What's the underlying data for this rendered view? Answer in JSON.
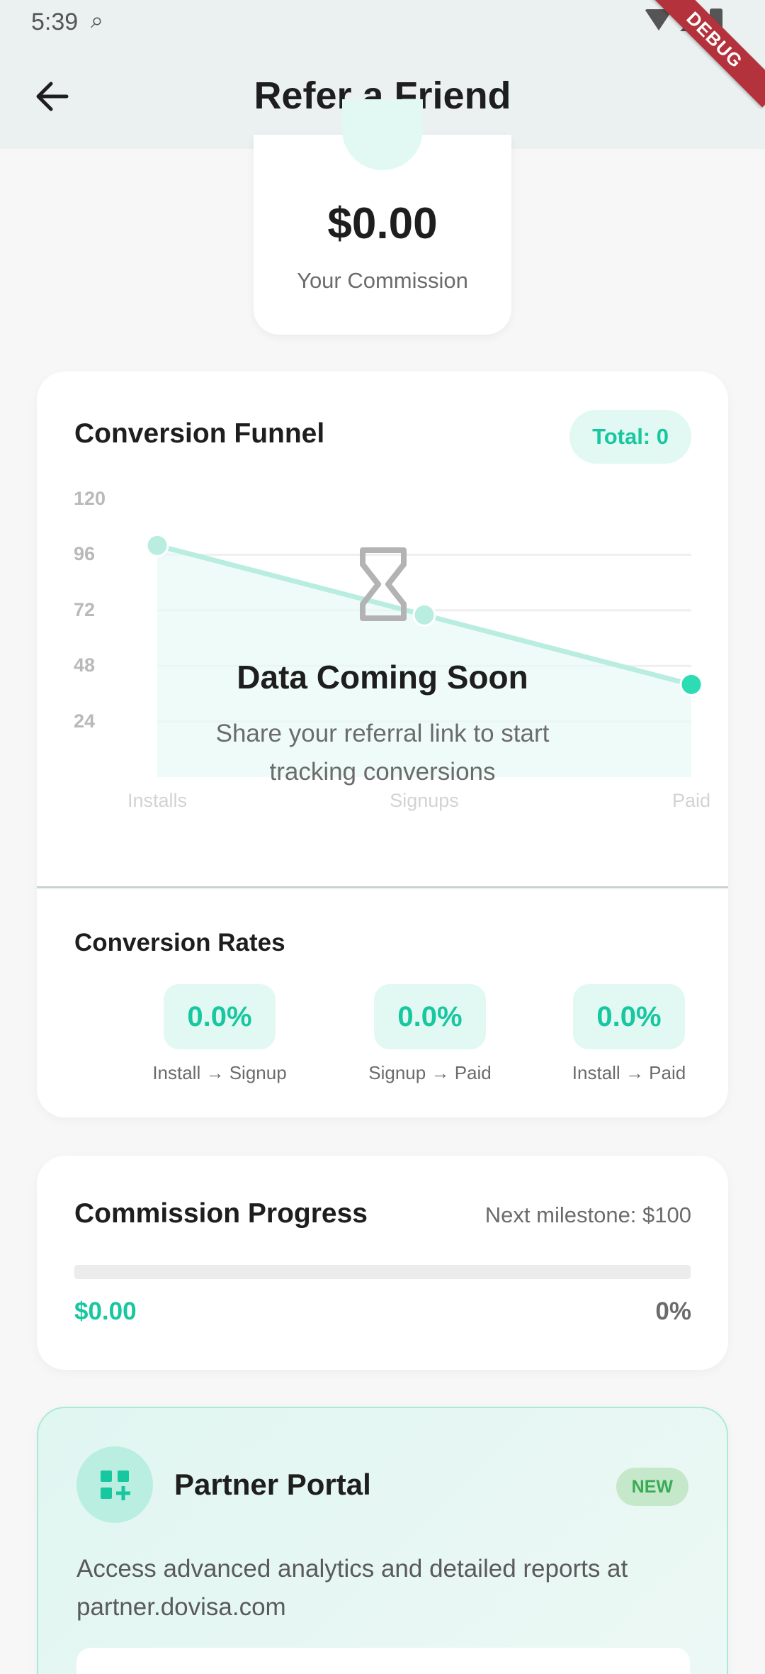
{
  "status_bar": {
    "time": "5:39",
    "debug_label": "DEBUG"
  },
  "app_bar": {
    "title": "Refer a Friend",
    "back_icon": "arrow-left-icon"
  },
  "commission": {
    "value": "$0.00",
    "label": "Your Commission"
  },
  "funnel": {
    "title": "Conversion Funnel",
    "total_label": "Total: 0",
    "empty_icon": "hourglass-icon",
    "empty_title": "Data Coming Soon",
    "empty_message": "Share your referral link to start tracking conversions",
    "rates_title": "Conversion Rates",
    "rates": [
      {
        "value": "0.0%",
        "from": "Install",
        "to": "Signup"
      },
      {
        "value": "0.0%",
        "from": "Signup",
        "to": "Paid"
      },
      {
        "value": "0.0%",
        "from": "Install",
        "to": "Paid"
      }
    ],
    "arrow": "→"
  },
  "chart_data": {
    "type": "line",
    "categories": [
      "Installs",
      "Signups",
      "Paid"
    ],
    "series": [
      {
        "values": [
          100,
          70,
          40
        ]
      }
    ],
    "y_ticks": [
      120,
      96,
      72,
      48,
      24
    ],
    "ylim": [
      0,
      120
    ],
    "grid": true,
    "fill_area": true,
    "colors": {
      "line": "#b9ede0",
      "point": "#2ddcb2",
      "fill": "#e8faf5",
      "grid": "#efefef"
    }
  },
  "progress": {
    "title": "Commission Progress",
    "next_milestone": "Next milestone: $100",
    "amount": "$0.00",
    "percent_label": "0%",
    "percent_value": 0
  },
  "partner": {
    "title": "Partner Portal",
    "badge": "NEW",
    "icon": "dashboard-add-icon",
    "description": "Access advanced analytics and detailed reports at partner.dovisa.com"
  },
  "colors": {
    "accent": "#17c7a0",
    "app_bar": "#eaf1f0",
    "background": "#f7f7f7",
    "debug": "#b3323b"
  }
}
